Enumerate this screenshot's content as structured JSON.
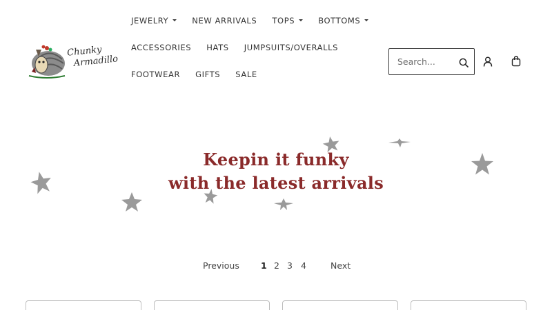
{
  "brand": {
    "logo_line1": "Chunky",
    "logo_line2": "Armadillo"
  },
  "nav": {
    "row1": [
      {
        "label": "JEWELRY",
        "dropdown": true
      },
      {
        "label": "NEW ARRIVALS",
        "dropdown": false
      },
      {
        "label": "TOPS",
        "dropdown": true
      },
      {
        "label": "BOTTOMS",
        "dropdown": true
      }
    ],
    "row2": [
      {
        "label": "ACCESSORIES"
      },
      {
        "label": "HATS"
      },
      {
        "label": "JUMPSUITS/OVERALLS"
      }
    ],
    "row3": [
      {
        "label": "FOOTWEAR"
      },
      {
        "label": "GIFTS"
      },
      {
        "label": "SALE"
      }
    ]
  },
  "search": {
    "placeholder": "Search...",
    "value": ""
  },
  "hero": {
    "line1": "Keepin it funky",
    "line2": "with the latest arrivals"
  },
  "pagination": {
    "previous": "Previous",
    "pages": [
      "1",
      "2",
      "3",
      "4"
    ],
    "current": "1",
    "next": "Next"
  },
  "icons": {
    "search": "search-icon",
    "account": "user-icon",
    "cart": "shopping-bag-icon",
    "dropdown": "caret-down-icon",
    "decor": "star-icon"
  },
  "colors": {
    "hero_text": "#8a2a2a",
    "star": "#9a9a9a",
    "nav_text": "#333333"
  }
}
